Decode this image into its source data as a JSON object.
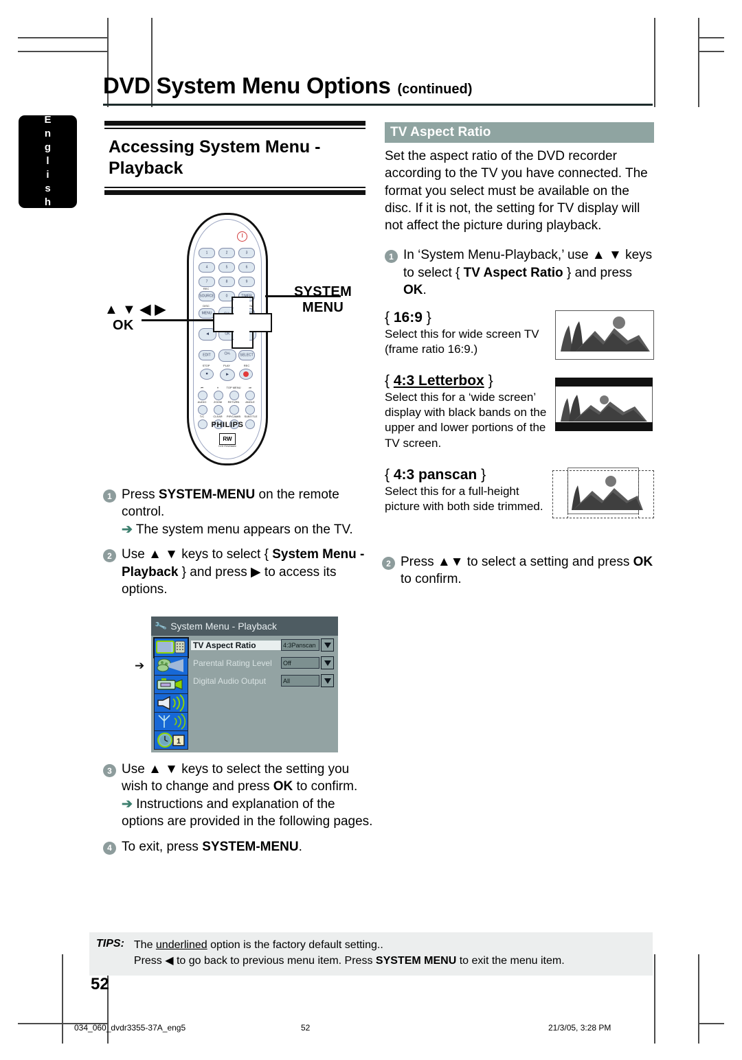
{
  "language_tab": {
    "label": "English"
  },
  "header": {
    "title": "DVD System Menu Options",
    "continued": "(continued)"
  },
  "left_column": {
    "section_title_line1": "Accessing System Menu -",
    "section_title_line2": "Playback",
    "remote": {
      "callout_nav_keys": "▲ ▼ ◀ ▶",
      "callout_ok": "OK",
      "callout_system_line1": "SYSTEM",
      "callout_system_line2": "MENU",
      "brand": "PHILIPS",
      "logo_mark": "RW",
      "logo_sub": "DVD+ReWritable",
      "buttons": {
        "numbers": [
          "1",
          "2",
          "3",
          "4",
          "5",
          "6",
          "7",
          "8",
          "9",
          "0"
        ],
        "rec_source": "SOURCE",
        "rec_source_top": "REC",
        "timer": "TIMER",
        "disc_top": "DISC",
        "disc_menu": "MENU",
        "system_top": "SYSTEM",
        "system_menu": "MENU",
        "ch_up": "CH+",
        "ch_down": "CH-",
        "ok": "OK",
        "edit": "EDIT",
        "select": "SELECT",
        "stop_label": "STOP",
        "play_label": "PLAY",
        "rec_label": "REC",
        "row_labels_1": [
          "⏮",
          "⏸",
          "TOP MENU",
          "⏭"
        ],
        "row_labels_2": [
          "AUDIO",
          "ZOOM",
          "RETURN",
          "ANGLE"
        ],
        "row_labels_3": [
          "T/C",
          "CLEAR",
          "PIP/CAM/B",
          "SUBTITLE"
        ]
      }
    },
    "steps": [
      {
        "num": "1",
        "html": "Press <b>SYSTEM-MENU</b> on the remote control.",
        "subs": [
          "The system menu appears on the TV."
        ]
      },
      {
        "num": "2",
        "html": "Use ▲ ▼ keys to select { <b>System Menu - Playback</b> } and press ▶ to access its options.",
        "subs": []
      },
      {
        "num": "3",
        "html": "Use ▲ ▼ keys to select the setting you wish to change and press <b>OK</b> to confirm.",
        "subs": [
          "Instructions and explanation of the options are provided in the following pages."
        ]
      },
      {
        "num": "4",
        "html": "To exit, press <b>SYSTEM-MENU</b>.",
        "subs": []
      }
    ],
    "tv_menu": {
      "title": "System Menu - Playback",
      "title_icon": "wrench-icon",
      "pointer_icon": "right-arrow-icon",
      "rows": [
        {
          "label": "TV Aspect Ratio",
          "value": "4:3Panscan",
          "active": true
        },
        {
          "label": "Parental Rating Level",
          "value": "Off",
          "active": false
        },
        {
          "label": "Digital Audio Output",
          "value": "All",
          "active": false
        }
      ],
      "icons": [
        "tv-settings-icon",
        "playback-icon",
        "recording-icon",
        "sound-icon",
        "installation-icon",
        "clock-date-icon"
      ],
      "selected_icon_index": 1
    }
  },
  "right_column": {
    "panel_title": "TV Aspect Ratio",
    "intro": "Set the aspect ratio of the DVD recorder according to the TV you have connected. The format you select must be available on the disc.  If it is not, the setting for TV display will not affect the picture during playback.",
    "step1": {
      "num": "1",
      "html": "In ‘System Menu-Playback,’ use ▲ ▼ keys to select { <b>TV Aspect Ratio</b> } and press <b>OK</b>."
    },
    "options": [
      {
        "open_brace": "{",
        "value": "16:9",
        "close_brace": "}",
        "underlined": false,
        "desc": "Select this for wide screen TV (frame ratio 16:9.)",
        "illustration": "widescreen-landscape-image"
      },
      {
        "open_brace": "{",
        "value": "4:3 Letterbox",
        "close_brace": "}",
        "underlined": true,
        "desc": "Select this for a ‘wide screen’ display with black bands on the upper and lower portions of the TV screen.",
        "illustration": "letterbox-landscape-image"
      },
      {
        "open_brace": "{",
        "value": "4:3 panscan",
        "close_brace": "}",
        "underlined": false,
        "desc": "Select this for a full-height picture with both side trimmed.",
        "illustration": "panscan-landscape-image"
      }
    ],
    "step2": {
      "num": "2",
      "html": "Press ▲▼ to select a setting and press <b>OK</b> to confirm."
    }
  },
  "tips": {
    "label": "TIPS:",
    "line1_pre": "The ",
    "line1_underlined": "underlined",
    "line1_post": " option is the factory default setting..",
    "line2_html": "Press ◀ to go back to previous menu item. Press <b>SYSTEM MENU</b> to exit the menu item."
  },
  "page_number": "52",
  "footer": {
    "file": "034_060_dvdr3355-37A_eng5",
    "page": "52",
    "timestamp": "21/3/05, 3:28 PM"
  },
  "colors": {
    "panel_header": "#8fa4a1",
    "step_bullet": "#8d9c9c",
    "arrow_green": "#3c7f6e",
    "tips_bg": "#eceeee",
    "menu_title_bar": "#4e5c62",
    "menu_bg": "#93a3a3",
    "menu_icon_blue": "#1768d6"
  }
}
